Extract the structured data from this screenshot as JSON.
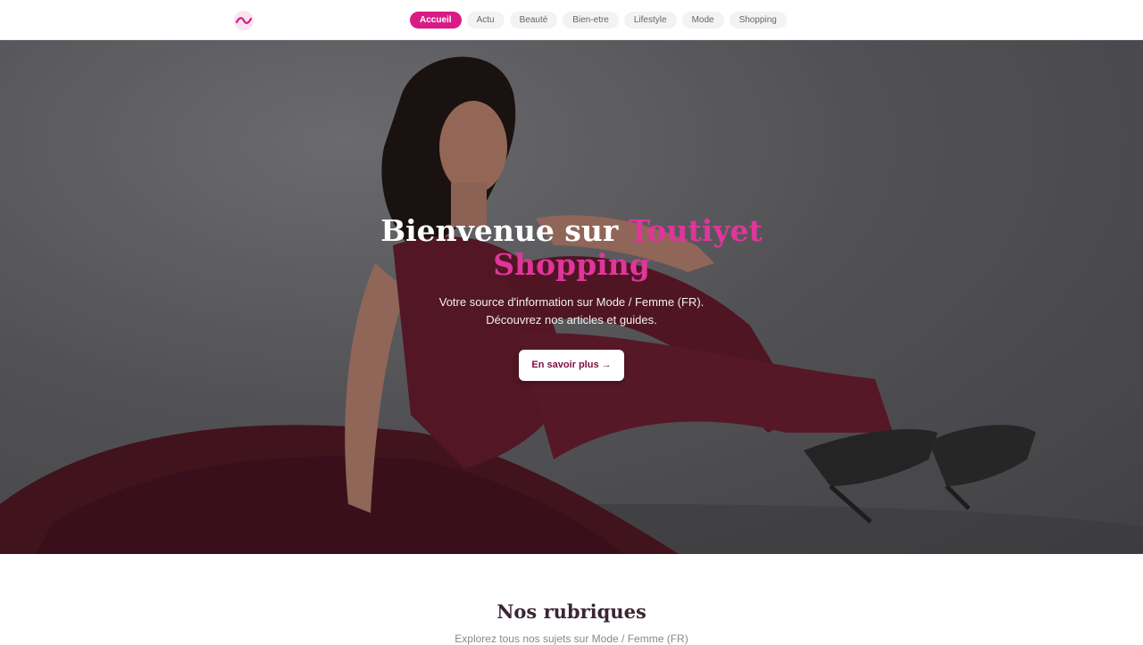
{
  "nav": {
    "items": [
      {
        "label": "Accueil",
        "active": true
      },
      {
        "label": "Actu"
      },
      {
        "label": "Beauté"
      },
      {
        "label": "Bien-etre"
      },
      {
        "label": "Lifestyle"
      },
      {
        "label": "Mode"
      },
      {
        "label": "Shopping"
      }
    ]
  },
  "logo": {
    "icon": "tilde-wave-icon"
  },
  "hero": {
    "title_part1": "Bienvenue sur ",
    "title_accent": "Toutiyet Shopping",
    "subtitle_line1": "Votre source d'information sur Mode / Femme (FR).",
    "subtitle_line2": "Découvrez nos articles et guides.",
    "cta_label": "En savoir plus →"
  },
  "section": {
    "title": "Nos rubriques",
    "subtitle": "Explorez tous nos sujets sur Mode / Femme (FR)"
  },
  "colors": {
    "accent": "#d81b85",
    "accent_text": "#e0359b"
  }
}
